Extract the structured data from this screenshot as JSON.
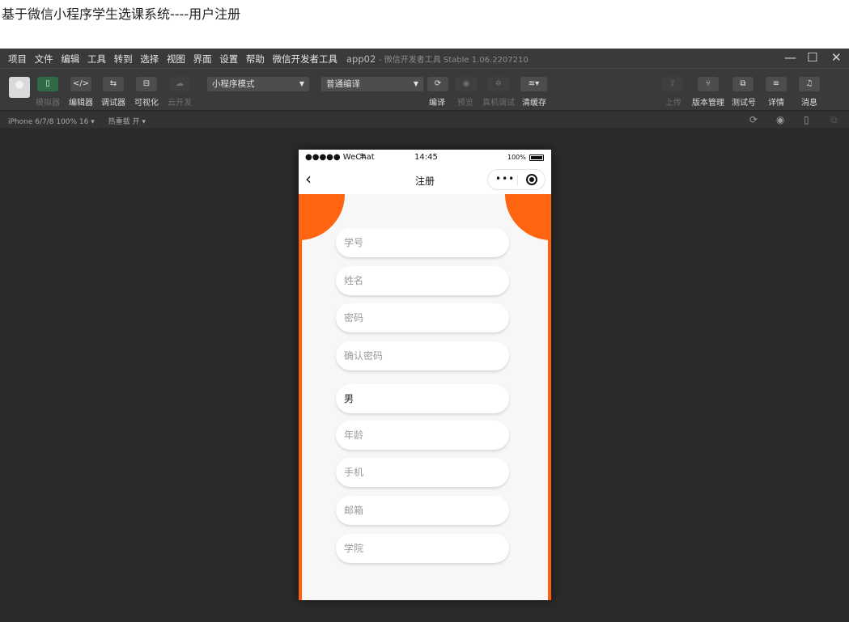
{
  "caption": "基于微信小程序学生选课系统----用户注册",
  "ide": {
    "menu": [
      "项目",
      "文件",
      "编辑",
      "工具",
      "转到",
      "选择",
      "视图",
      "界面",
      "设置",
      "帮助",
      "微信开发者工具"
    ],
    "window_title": "app02",
    "window_subtitle": "- 微信开发者工具 Stable 1.06.2207210",
    "window_controls": {
      "minimize": "—",
      "maximize": "☐",
      "close": "✕"
    },
    "toolbar_left": [
      {
        "label": "模拟器",
        "icon": "phone-icon",
        "glyph": "▯"
      },
      {
        "label": "编辑器",
        "icon": "code-icon",
        "glyph": "</>"
      },
      {
        "label": "调试器",
        "icon": "debug-icon",
        "glyph": "⇆"
      },
      {
        "label": "可视化",
        "icon": "layout-icon",
        "glyph": "⊟"
      },
      {
        "label": "云开发",
        "icon": "cloud-icon",
        "glyph": "☁"
      }
    ],
    "mode_select": "小程序模式",
    "compile_select": "普通编译",
    "toolbar_mid": [
      {
        "label": "编译",
        "icon": "refresh-icon",
        "glyph": "⟳"
      },
      {
        "label": "预览",
        "icon": "eye-icon",
        "glyph": "◉"
      },
      {
        "label": "真机调试",
        "icon": "bug-icon",
        "glyph": "✲"
      },
      {
        "label": "清缓存",
        "icon": "layers-icon",
        "glyph": "≋▾"
      }
    ],
    "toolbar_right": [
      {
        "label": "上传",
        "icon": "upload-icon",
        "glyph": "⇪"
      },
      {
        "label": "版本管理",
        "icon": "branch-icon",
        "glyph": "⑂"
      },
      {
        "label": "测试号",
        "icon": "external-icon",
        "glyph": "⧉"
      },
      {
        "label": "详情",
        "icon": "menu-icon",
        "glyph": "≡"
      },
      {
        "label": "消息",
        "icon": "bell-icon",
        "glyph": "♫"
      }
    ],
    "device_info": "iPhone 6/7/8 100% 16 ▾",
    "hot_reload": "热重载 开 ▾"
  },
  "phone": {
    "carrier": "●●●●● WeChat",
    "time": "14:45",
    "battery": "100%",
    "nav_title": "注册",
    "form": [
      {
        "name": "student-id",
        "placeholder": "学号"
      },
      {
        "name": "name",
        "placeholder": "姓名"
      },
      {
        "name": "password",
        "placeholder": "密码"
      },
      {
        "name": "confirm-password",
        "placeholder": "确认密码"
      },
      {
        "name": "gender",
        "value": "男"
      },
      {
        "name": "age",
        "placeholder": "年龄"
      },
      {
        "name": "phone",
        "placeholder": "手机"
      },
      {
        "name": "email",
        "placeholder": "邮箱"
      },
      {
        "name": "college",
        "placeholder": "学院"
      }
    ]
  },
  "colors": {
    "accent": "#ff6410",
    "ide_bg": "#2b2b2b",
    "toolbar_bg": "#3a3a3a"
  }
}
